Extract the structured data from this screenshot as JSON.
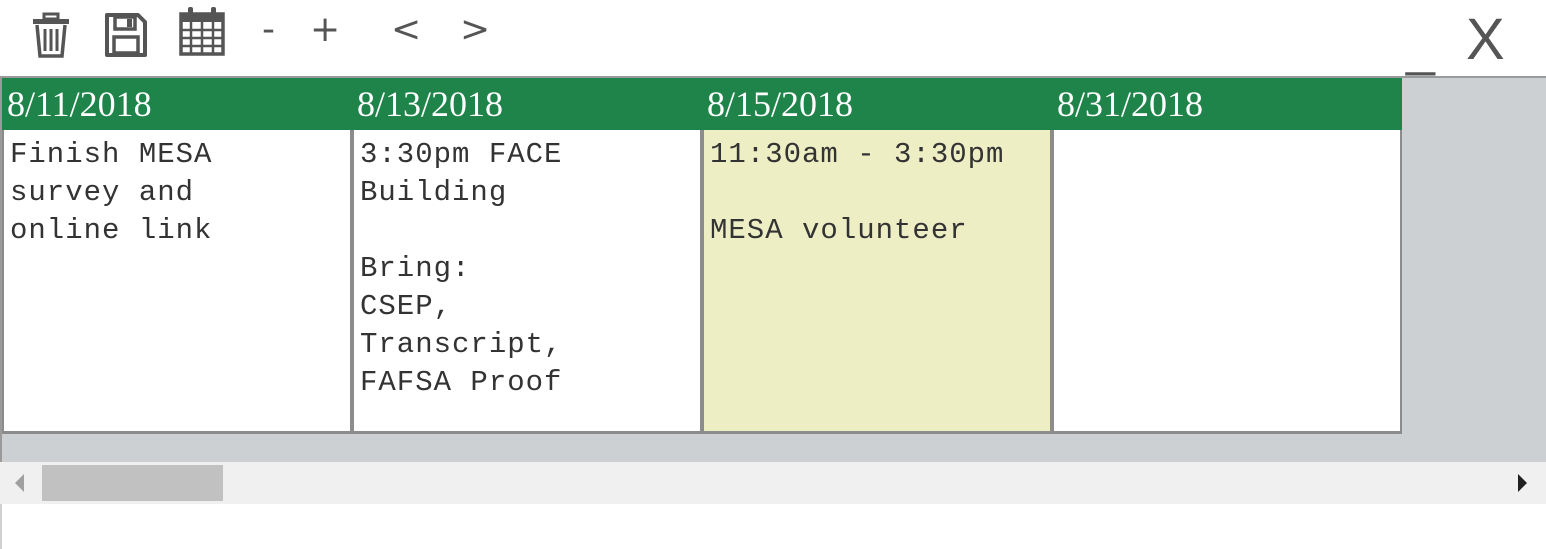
{
  "toolbar": {
    "icons": [
      "trash-icon",
      "save-icon",
      "calendar-icon"
    ],
    "zoom_out_label": "-",
    "zoom_in_label": "+",
    "prev_label": "<",
    "next_label": ">",
    "minimize_label": "_",
    "close_label": "X"
  },
  "colors": {
    "header_green": "#1e8449",
    "highlight_yellow": "#eeeec5",
    "board_gray": "#cdd0d3"
  },
  "columns": [
    {
      "date": "8/11/2018",
      "note": "Finish MESA\nsurvey and\nonline link",
      "highlighted": false
    },
    {
      "date": "8/13/2018",
      "note": "3:30pm FACE\nBuilding\n\nBring:\nCSEP,\nTranscript,\nFAFSA Proof",
      "highlighted": false
    },
    {
      "date": "8/15/2018",
      "note": "11:30am - 3:30pm\n\nMESA volunteer",
      "highlighted": true
    },
    {
      "date": "8/31/2018",
      "note": "",
      "highlighted": false
    }
  ]
}
